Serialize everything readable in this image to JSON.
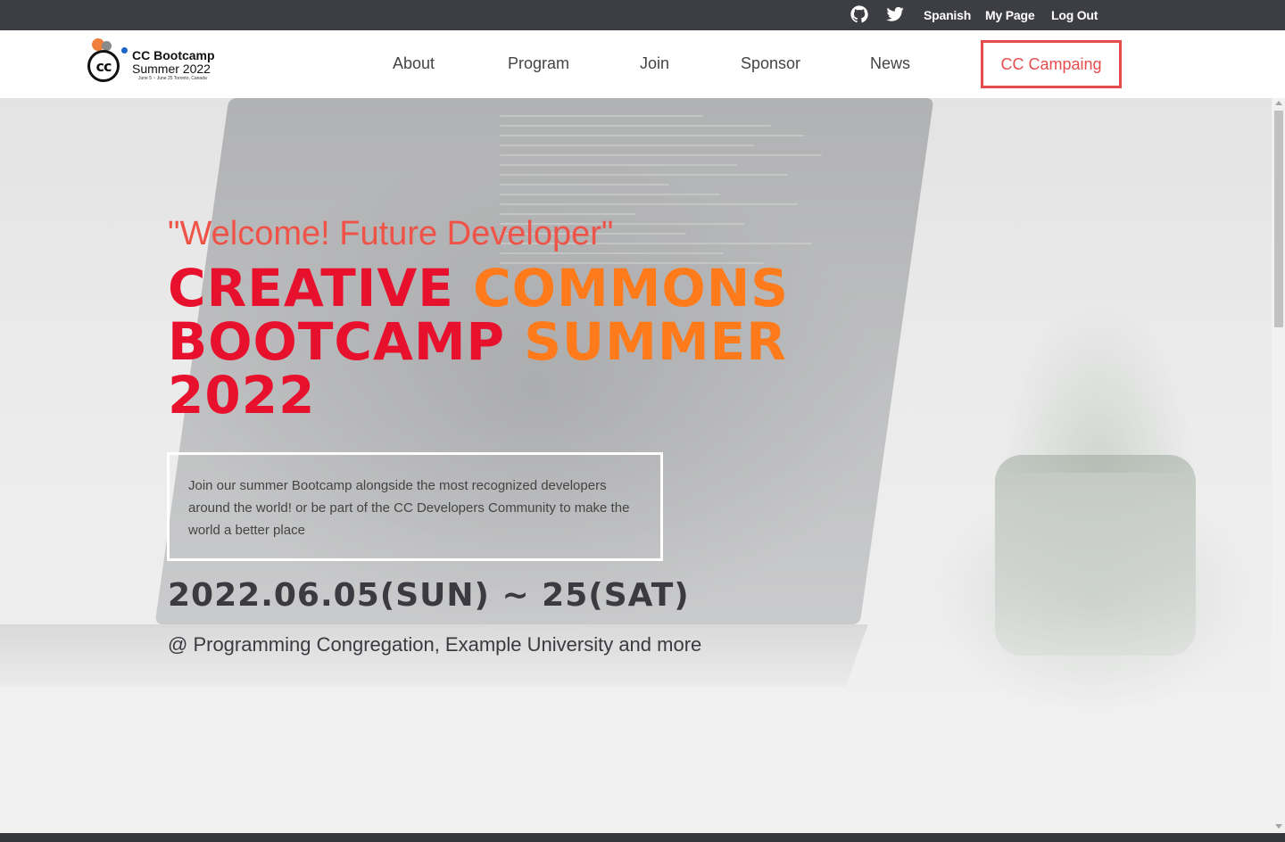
{
  "topbar": {
    "icons": [
      "github-icon",
      "twitter-icon"
    ],
    "language": "Spanish",
    "my_page": "My Page",
    "logout": "Log Out"
  },
  "logo": {
    "mark": "cc",
    "title": "CC Bootcamp",
    "subtitle": "Summer 2022",
    "dates": "June 5 ~ June 25  Toronto, Canada"
  },
  "nav": {
    "items": [
      "About",
      "Program",
      "Join",
      "Sponsor",
      "News"
    ],
    "cta": "CC Campaing"
  },
  "hero": {
    "welcome": "\"Welcome! Future Developer\"",
    "headline": {
      "line1_red": "CREATIVE ",
      "line1_orange": "COMMONS",
      "line2_red": "BOOTCAMP ",
      "line2_orange": "SUMMER",
      "line3_red": "2022"
    },
    "intro": "Join our summer Bootcamp alongside the most recognized developers around the world! or be part of the CC Developers Community to make the world a better place",
    "dates": "2022.06.05(SUN) ~ 25(SAT)",
    "venue": "@ Programming Congregation, Example University and more"
  },
  "colors": {
    "topbar_bg": "#3d3e44",
    "accent": "#e74c4c",
    "headline_red": "#e8112d",
    "headline_orange": "#ff7a1a",
    "text_dark": "#3a3a40"
  }
}
